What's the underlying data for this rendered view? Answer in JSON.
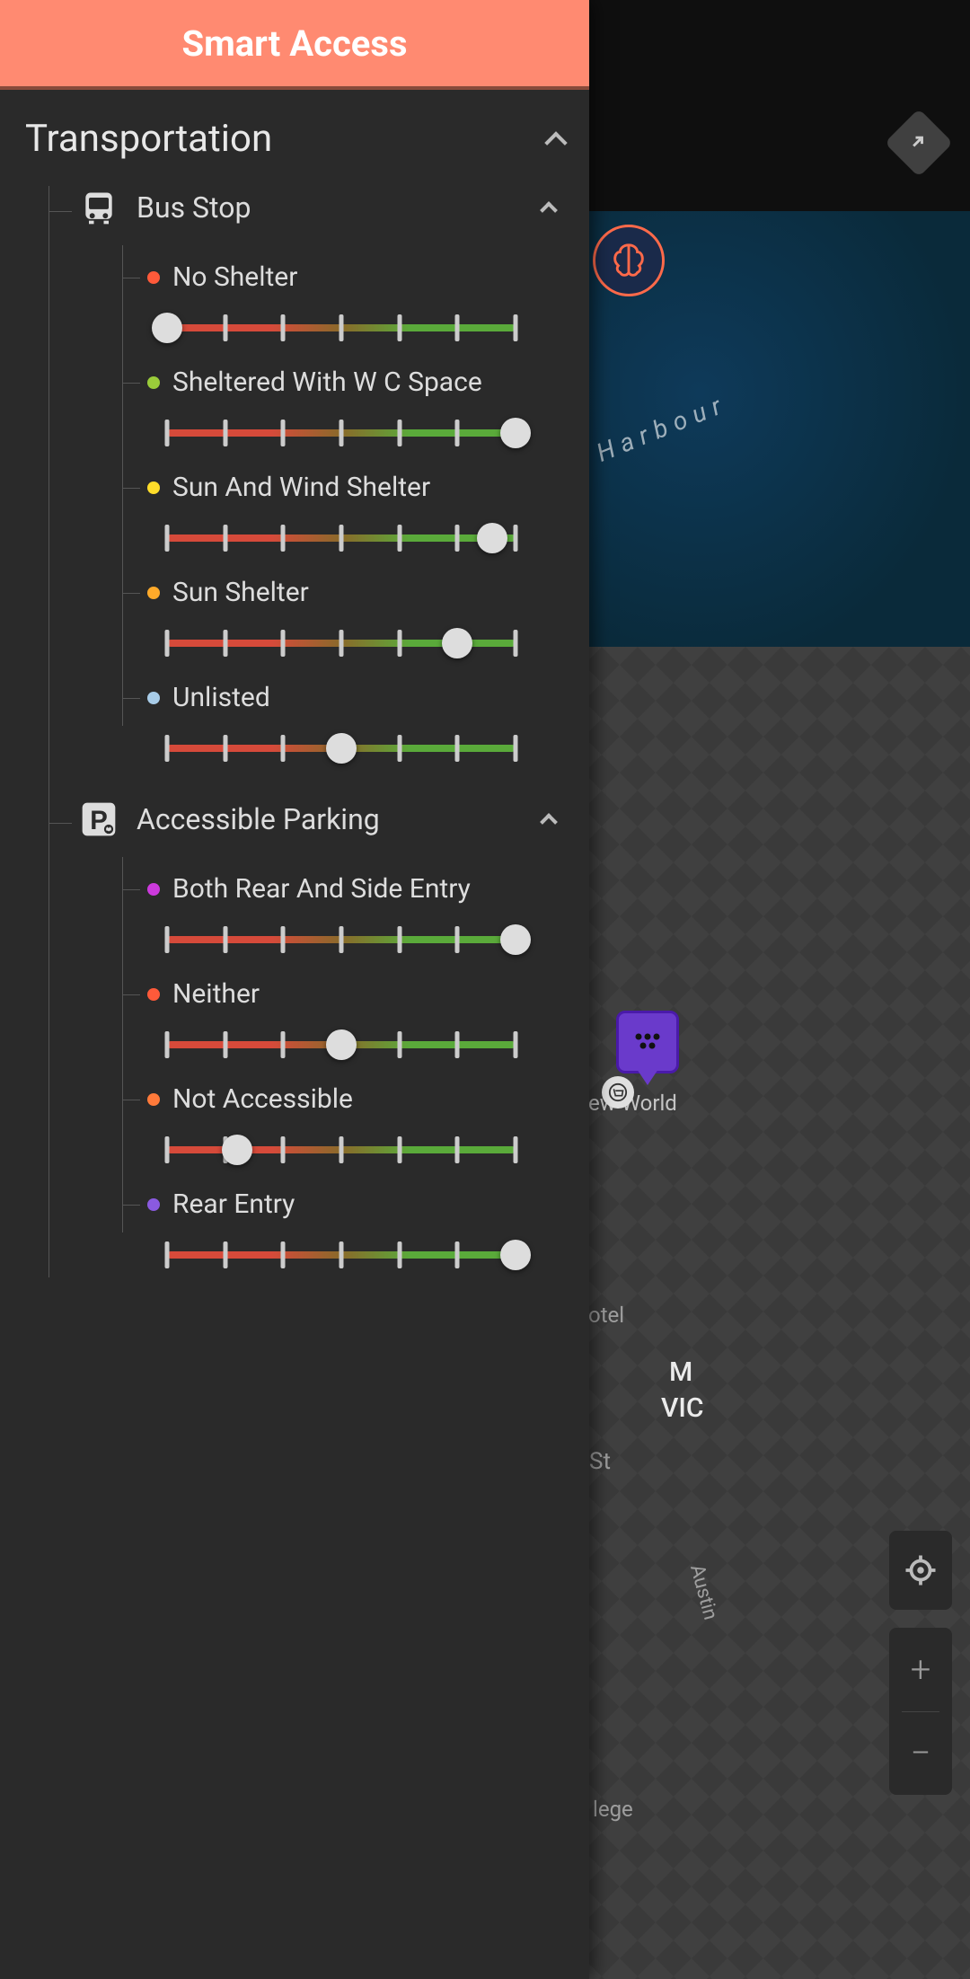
{
  "app_title": "Smart Access",
  "section": {
    "title": "Transportation"
  },
  "categories": [
    {
      "id": "bus-stop",
      "icon": "bus",
      "title": "Bus Stop",
      "items": [
        {
          "label": "No Shelter",
          "dot_color": "#ff5a3a",
          "value": 0
        },
        {
          "label": "Sheltered With W C Space",
          "dot_color": "#9acc3a",
          "value": 6
        },
        {
          "label": "Sun And Wind Shelter",
          "dot_color": "#ffdd2a",
          "value": 5.6
        },
        {
          "label": "Sun Shelter",
          "dot_color": "#ffaa2a",
          "value": 5
        },
        {
          "label": "Unlisted",
          "dot_color": "#a8cce8",
          "value": 3
        }
      ]
    },
    {
      "id": "accessible-parking",
      "icon": "parking",
      "title": "Accessible Parking",
      "items": [
        {
          "label": "Both Rear And Side Entry",
          "dot_color": "#cc3add",
          "value": 6
        },
        {
          "label": "Neither",
          "dot_color": "#ff5a3a",
          "value": 3
        },
        {
          "label": "Not Accessible",
          "dot_color": "#ff7a3a",
          "value": 1.2
        },
        {
          "label": "Rear Entry",
          "dot_color": "#8a5ae0",
          "value": 6
        }
      ]
    }
  ],
  "slider": {
    "min": 0,
    "max": 6,
    "ticks": 7
  },
  "map": {
    "harbour_label": "Harbour",
    "labels": {
      "newworld": "ew World",
      "otel": "otel",
      "st": "St",
      "austin": "Austin",
      "lege": "lege",
      "m": "M",
      "vic": "VIC"
    }
  },
  "controls": {
    "zoom_in": "+",
    "zoom_out": "−"
  }
}
